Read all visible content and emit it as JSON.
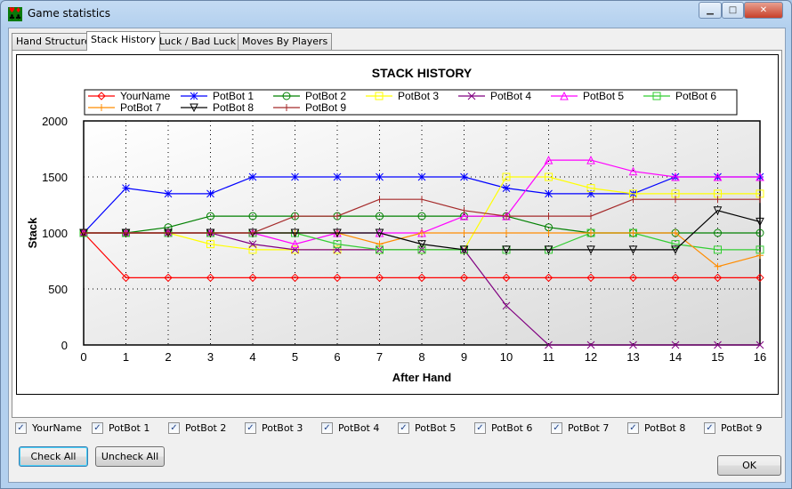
{
  "window": {
    "title": "Game statistics",
    "app_icon": "cards-icon",
    "controls": [
      "minimize",
      "maximize",
      "close"
    ]
  },
  "tabs": [
    {
      "label": "Hand Structure"
    },
    {
      "label": "Stack History",
      "active": true
    },
    {
      "label": "Luck / Bad Luck"
    },
    {
      "label": "Moves By Players"
    }
  ],
  "chart_data": {
    "type": "line",
    "title": "STACK HISTORY",
    "xlabel": "After Hand",
    "ylabel": "Stack",
    "xlim": [
      0,
      16
    ],
    "ylim": [
      0,
      2000
    ],
    "xticks": [
      "0",
      "1",
      "2",
      "3",
      "4",
      "5",
      "6",
      "7",
      "8",
      "9",
      "10",
      "11",
      "12",
      "13",
      "14",
      "15",
      "16"
    ],
    "yticks": [
      "0",
      "500",
      "1000",
      "1500",
      "2000"
    ],
    "grid": true,
    "legend_position": "top",
    "x": [
      0,
      1,
      2,
      3,
      4,
      5,
      6,
      7,
      8,
      9,
      10,
      11,
      12,
      13,
      14,
      15,
      16
    ],
    "series": [
      {
        "name": "YourName",
        "color": "#ff0000",
        "marker": "diamond",
        "values": [
          1000,
          600,
          600,
          600,
          600,
          600,
          600,
          600,
          600,
          600,
          600,
          600,
          600,
          600,
          600,
          600,
          600
        ]
      },
      {
        "name": "PotBot 1",
        "color": "#0000ff",
        "marker": "asterisk",
        "values": [
          1000,
          1400,
          1350,
          1350,
          1500,
          1500,
          1500,
          1500,
          1500,
          1500,
          1400,
          1350,
          1350,
          1350,
          1500,
          1500,
          1500
        ]
      },
      {
        "name": "PotBot 2",
        "color": "#008000",
        "marker": "circle",
        "values": [
          1000,
          1000,
          1050,
          1150,
          1150,
          1150,
          1150,
          1150,
          1150,
          1150,
          1150,
          1050,
          1000,
          1000,
          1000,
          1000,
          1000
        ]
      },
      {
        "name": "PotBot 3",
        "color": "#ffff00",
        "marker": "square",
        "values": [
          1000,
          1000,
          1000,
          900,
          850,
          850,
          850,
          850,
          850,
          850,
          1500,
          1500,
          1400,
          1350,
          1350,
          1350,
          1350
        ]
      },
      {
        "name": "PotBot 4",
        "color": "#800080",
        "marker": "x",
        "values": [
          1000,
          1000,
          1000,
          1000,
          900,
          850,
          850,
          850,
          850,
          850,
          350,
          0,
          0,
          0,
          0,
          0,
          0
        ]
      },
      {
        "name": "PotBot 5",
        "color": "#ff00ff",
        "marker": "triangle",
        "values": [
          1000,
          1000,
          1000,
          1000,
          1000,
          900,
          1000,
          1000,
          1000,
          1150,
          1150,
          1650,
          1650,
          1550,
          1500,
          1500,
          1500
        ]
      },
      {
        "name": "PotBot 6",
        "color": "#32cd32",
        "marker": "square",
        "values": [
          1000,
          1000,
          1000,
          1000,
          1000,
          1000,
          900,
          850,
          850,
          850,
          850,
          850,
          1000,
          1000,
          900,
          850,
          850
        ]
      },
      {
        "name": "PotBot 7",
        "color": "#ff8c00",
        "marker": "plus",
        "values": [
          1000,
          1000,
          1000,
          1000,
          1000,
          1000,
          1000,
          900,
          1000,
          1000,
          1000,
          1000,
          1000,
          1000,
          1000,
          700,
          800
        ]
      },
      {
        "name": "PotBot 8",
        "color": "#000000",
        "marker": "triangle-down",
        "values": [
          1000,
          1000,
          1000,
          1000,
          1000,
          1000,
          1000,
          1000,
          900,
          850,
          850,
          850,
          850,
          850,
          850,
          1200,
          1100
        ]
      },
      {
        "name": "PotBot 9",
        "color": "#a52a2a",
        "marker": "vtick",
        "values": [
          1000,
          1000,
          1000,
          1000,
          1000,
          1150,
          1150,
          1300,
          1300,
          1200,
          1150,
          1150,
          1150,
          1300,
          1300,
          1300,
          1300
        ]
      }
    ]
  },
  "checkboxes": [
    {
      "label": "YourName",
      "checked": true
    },
    {
      "label": "PotBot 1",
      "checked": true
    },
    {
      "label": "PotBot 2",
      "checked": true
    },
    {
      "label": "PotBot 3",
      "checked": true
    },
    {
      "label": "PotBot 4",
      "checked": true
    },
    {
      "label": "PotBot 5",
      "checked": true
    },
    {
      "label": "PotBot 6",
      "checked": true
    },
    {
      "label": "PotBot 7",
      "checked": true
    },
    {
      "label": "PotBot 8",
      "checked": true
    },
    {
      "label": "PotBot 9",
      "checked": true
    }
  ],
  "buttons": {
    "check_all": "Check All",
    "uncheck_all": "Uncheck All",
    "ok": "OK"
  },
  "check_mark": "✓"
}
